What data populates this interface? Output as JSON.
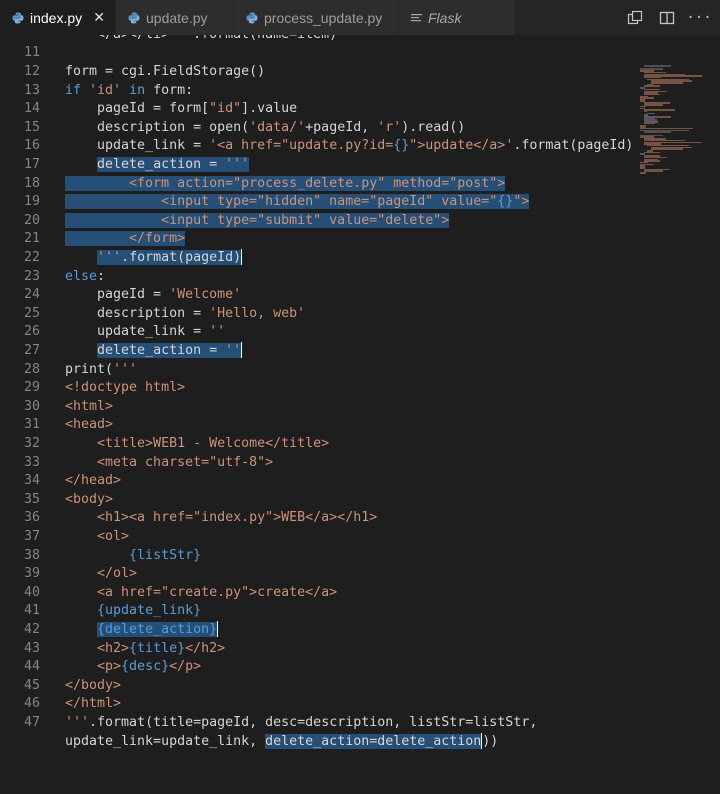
{
  "tabs": [
    {
      "label": "index.py",
      "active": true,
      "close": "✕"
    },
    {
      "label": "update.py",
      "active": false
    },
    {
      "label": "process_update.py",
      "active": false
    },
    {
      "label": "Flask",
      "active": false
    }
  ],
  "actions": [
    {
      "name": "open-changes-icon"
    },
    {
      "name": "split-editor-icon"
    },
    {
      "name": "more-actions-icon",
      "glyph": "···"
    }
  ],
  "colors": {
    "keyword": "#569cd6",
    "string": "#ce9178",
    "selection": "#264f78",
    "text": "#d4d4d4"
  },
  "lines": [
    {
      "n": "",
      "segs": [
        {
          "t": "    </a></li>'''.format(name=item)"
        }
      ]
    },
    {
      "n": "11",
      "segs": []
    },
    {
      "n": "12",
      "segs": [
        {
          "t": "form = cgi.FieldStorage()"
        }
      ]
    },
    {
      "n": "13",
      "segs": [
        {
          "t": "if",
          "c": "kw"
        },
        {
          "t": " "
        },
        {
          "t": "'id'",
          "c": "str"
        },
        {
          "t": " "
        },
        {
          "t": "in",
          "c": "kw"
        },
        {
          "t": " form:"
        }
      ]
    },
    {
      "n": "14",
      "segs": [
        {
          "t": "    pageId = form["
        },
        {
          "t": "\"id\"",
          "c": "str"
        },
        {
          "t": "].value"
        }
      ]
    },
    {
      "n": "15",
      "segs": [
        {
          "t": "    description = open("
        },
        {
          "t": "'data/'",
          "c": "str"
        },
        {
          "t": "+pageId, "
        },
        {
          "t": "'r'",
          "c": "str"
        },
        {
          "t": ").read()"
        }
      ]
    },
    {
      "n": "16",
      "segs": [
        {
          "t": "    update_link = "
        },
        {
          "t": "'<a href=\"update.py?id=",
          "c": "str"
        },
        {
          "t": "{}",
          "c": "br"
        },
        {
          "t": "\">update</a>'",
          "c": "str"
        },
        {
          "t": ".format(pageId)"
        }
      ]
    },
    {
      "n": "17",
      "segs": [
        {
          "t": "    "
        },
        {
          "t": "delete_action = ",
          "s": 1
        },
        {
          "t": "'''",
          "c": "str",
          "s": 1
        }
      ]
    },
    {
      "n": "18",
      "segs": [
        {
          "t": "        <form action=\"process_delete.py\" method=\"post\">",
          "c": "str",
          "s": 1
        }
      ]
    },
    {
      "n": "19",
      "segs": [
        {
          "t": "            <input type=\"hidden\" name=\"pageId\" value=\"",
          "c": "str",
          "s": 1
        },
        {
          "t": "{}",
          "c": "br",
          "s": 1
        },
        {
          "t": "\">",
          "c": "str",
          "s": 1
        }
      ]
    },
    {
      "n": "20",
      "segs": [
        {
          "t": "            <input type=\"submit\" value=\"delete\">",
          "c": "str",
          "s": 1
        }
      ]
    },
    {
      "n": "21",
      "segs": [
        {
          "t": "        </form>",
          "c": "str",
          "s": 1
        }
      ]
    },
    {
      "n": "22",
      "segs": [
        {
          "t": "    "
        },
        {
          "t": "'''",
          "c": "str",
          "s": 1
        },
        {
          "t": ".format(pageId)",
          "s": 1
        },
        {
          "cursor": 1
        }
      ]
    },
    {
      "n": "23",
      "segs": [
        {
          "t": "else",
          "c": "kw"
        },
        {
          "t": ":"
        }
      ]
    },
    {
      "n": "24",
      "segs": [
        {
          "t": "    pageId = "
        },
        {
          "t": "'Welcome'",
          "c": "str"
        }
      ]
    },
    {
      "n": "25",
      "segs": [
        {
          "t": "    description = "
        },
        {
          "t": "'Hello, web'",
          "c": "str"
        }
      ]
    },
    {
      "n": "26",
      "segs": [
        {
          "t": "    update_link = "
        },
        {
          "t": "''",
          "c": "str"
        }
      ]
    },
    {
      "n": "27",
      "segs": [
        {
          "t": "    "
        },
        {
          "t": "delete_action = ",
          "s": 1
        },
        {
          "t": "''",
          "c": "str",
          "s": 1
        },
        {
          "cursor": 1
        }
      ]
    },
    {
      "n": "28",
      "segs": [
        {
          "t": "print("
        },
        {
          "t": "'''",
          "c": "str"
        }
      ]
    },
    {
      "n": "29",
      "segs": [
        {
          "t": "<!doctype html>",
          "c": "str"
        }
      ]
    },
    {
      "n": "30",
      "segs": [
        {
          "t": "<html>",
          "c": "str"
        }
      ]
    },
    {
      "n": "31",
      "segs": [
        {
          "t": "<head>",
          "c": "str"
        }
      ]
    },
    {
      "n": "32",
      "segs": [
        {
          "t": "    <title>WEB1 - Welcome</title>",
          "c": "str"
        }
      ]
    },
    {
      "n": "33",
      "segs": [
        {
          "t": "    <meta charset=\"utf-8\">",
          "c": "str"
        }
      ]
    },
    {
      "n": "34",
      "segs": [
        {
          "t": "</head>",
          "c": "str"
        }
      ]
    },
    {
      "n": "35",
      "segs": [
        {
          "t": "<body>",
          "c": "str"
        }
      ]
    },
    {
      "n": "36",
      "segs": [
        {
          "t": "    <h1><a href=\"index.py\">WEB</a></h1>",
          "c": "str"
        }
      ]
    },
    {
      "n": "37",
      "segs": [
        {
          "t": "    <ol>",
          "c": "str"
        }
      ]
    },
    {
      "n": "38",
      "segs": [
        {
          "t": "        "
        },
        {
          "t": "{listStr}",
          "c": "br"
        }
      ]
    },
    {
      "n": "39",
      "segs": [
        {
          "t": "    </ol>",
          "c": "str"
        }
      ]
    },
    {
      "n": "40",
      "segs": [
        {
          "t": "    <a href=\"create.py\">create</a>",
          "c": "str"
        }
      ]
    },
    {
      "n": "41",
      "segs": [
        {
          "t": "    "
        },
        {
          "t": "{update_link}",
          "c": "br"
        }
      ]
    },
    {
      "n": "42",
      "segs": [
        {
          "t": "    "
        },
        {
          "t": "{delete_action}",
          "c": "br",
          "s": 1
        },
        {
          "cursor": 1
        }
      ]
    },
    {
      "n": "43",
      "segs": [
        {
          "t": "    <h2>",
          "c": "str"
        },
        {
          "t": "{title}",
          "c": "br"
        },
        {
          "t": "</h2>",
          "c": "str"
        }
      ]
    },
    {
      "n": "44",
      "segs": [
        {
          "t": "    <p>",
          "c": "str"
        },
        {
          "t": "{desc}",
          "c": "br"
        },
        {
          "t": "</p>",
          "c": "str"
        }
      ]
    },
    {
      "n": "45",
      "segs": [
        {
          "t": "</body>",
          "c": "str"
        }
      ]
    },
    {
      "n": "46",
      "segs": [
        {
          "t": "</html>",
          "c": "str"
        }
      ]
    },
    {
      "n": "47",
      "segs": [
        {
          "t": "'''",
          "c": "str"
        },
        {
          "t": ".format(title=pageId, desc=description, listStr=listStr,"
        }
      ]
    },
    {
      "n": "",
      "segs": [
        {
          "t": "update_link=update_link, "
        },
        {
          "t": "delete_action=delete_action",
          "s": 1
        },
        {
          "cursor": 1
        },
        {
          "t": "))"
        }
      ]
    }
  ]
}
